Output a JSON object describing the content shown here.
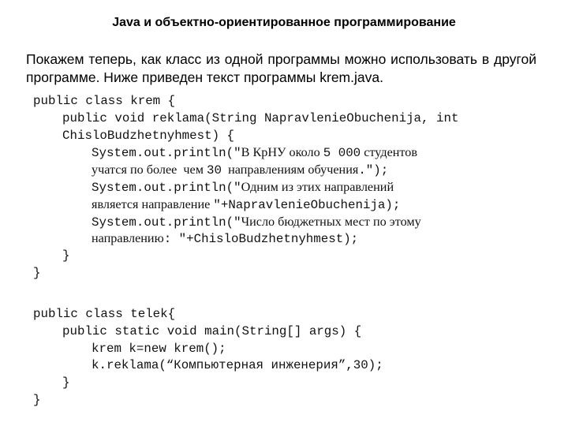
{
  "slide": {
    "title": "Java и объектно-ориентированное программирование",
    "intro": "Покажем теперь, как класс из одной программы можно использовать в другой программе. Ниже приведен текст программы krem.java."
  },
  "code_krem": {
    "l1": "public class krem {",
    "l2": "public void reklama(String NapravlenieObuchenija, int",
    "l3": "ChisloBudzhetnyhmest) {",
    "l4a": "System.out.println(\"",
    "l4b": "В КрНУ около ",
    "l4c": "5 000",
    "l4d": " студентов",
    "l5a": "учатся по более  чем ",
    "l5b": "30",
    "l5c": "  направлениям обучения",
    "l5d": ".\");",
    "l6a": "System.out.println(\"",
    "l6b": "Одним из этих направлений",
    "l7a": "является направление ",
    "l7b": "\"+NapravlenieObuchenija);",
    "l8a": "System.out.println(\"",
    "l8b": "Число бюджетных мест по этому",
    "l9a": "направлению",
    "l9b": ": \"+ChisloBudzhetnyhmest);",
    "l10": "}",
    "l11": "}"
  },
  "code_telek": {
    "l1": "public class telek{",
    "l2": "public static void main(String[] args) {",
    "l3": "krem k=new krem();",
    "l4": "k.reklama(“Компьютерная инженерия”,30);",
    "l5": "}",
    "l6": "}"
  }
}
